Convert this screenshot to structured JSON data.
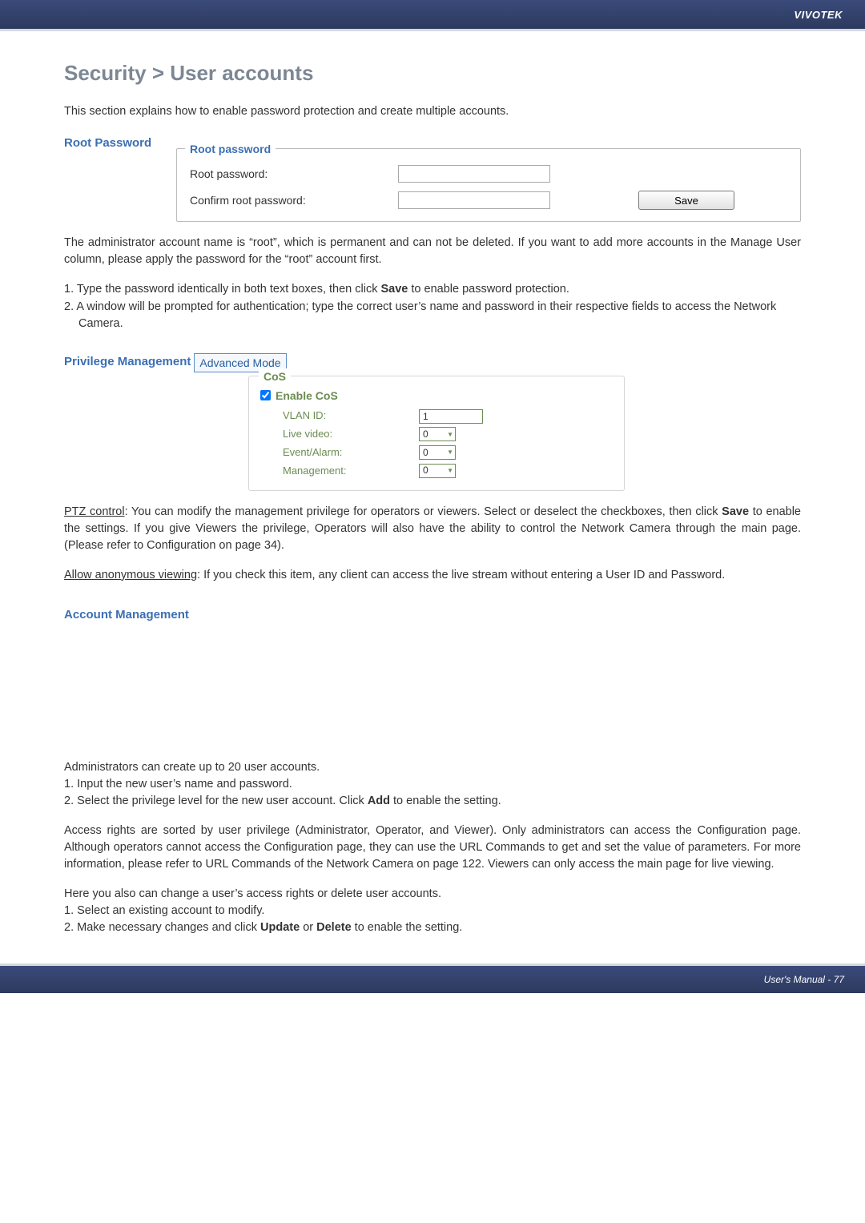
{
  "header": {
    "brand": "VIVOTEK"
  },
  "page": {
    "title": "Security > User accounts",
    "intro": "This section explains how to enable password protection and create multiple accounts."
  },
  "root_password": {
    "section_title": "Root Password",
    "legend": "Root password",
    "label_pw": "Root password:",
    "label_confirm": "Confirm root password:",
    "save_label": "Save",
    "para": "The administrator account name is “root”, which is permanent and can not be deleted. If you want to add more accounts in the Manage User column, please apply the password for the “root” account first.",
    "step1_pre": "1. Type the password identically in both text boxes, then click ",
    "step1_bold": "Save",
    "step1_post": " to enable password protection.",
    "step2": "2. A window will be prompted for authentication; type the correct user’s name and password in their respective fields to access the Network Camera."
  },
  "privilege": {
    "section_title": "Privilege Management",
    "badge": "Advanced Mode",
    "cos_legend": "CoS",
    "enable_cos": "Enable CoS",
    "rows": {
      "vlan_label": "VLAN ID:",
      "vlan_value": "1",
      "live_label": "Live video:",
      "live_value": "0",
      "event_label": "Event/Alarm:",
      "event_value": "0",
      "mgmt_label": "Management:",
      "mgmt_value": "0"
    },
    "ptz_label": "PTZ control",
    "ptz_text_pre": ": You can modify the management privilege for operators or viewers. Select or deselect the checkboxes, then click ",
    "ptz_text_bold": "Save",
    "ptz_text_post": " to enable the settings. If you give Viewers the privilege, Operators will also have the ability to control the Network Camera through the main page. (Please refer to Configuration on page 34).",
    "anon_label": "Allow anonymous viewing",
    "anon_text": ": If you check this item, any client can access the live stream without entering a User ID and Password."
  },
  "account_mgmt": {
    "section_title": "Account Management",
    "p1": "Administrators can create up to 20 user accounts.",
    "s1": "1. Input the new user’s name and password.",
    "s2_pre": "2. Select the privilege level for the new user account. Click ",
    "s2_bold": "Add",
    "s2_post": " to enable the setting.",
    "p2": "Access rights are sorted by user privilege (Administrator, Operator, and Viewer). Only administrators can access the Configuration page. Although operators cannot access the Configuration page, they can use the URL Commands to get and set the value of parameters. For more information, please refer to URL Commands of the Network Camera on page 122. Viewers can only access the main page for live viewing.",
    "p3": "Here you also can change a user’s access rights or delete user accounts.",
    "c1": "1. Select an existing account to modify.",
    "c2_pre": "2. Make necessary changes and click ",
    "c2_bold1": "Update",
    "c2_mid": " or ",
    "c2_bold2": "Delete",
    "c2_post": " to enable the setting."
  },
  "footer": {
    "text": "User's Manual - 77"
  }
}
